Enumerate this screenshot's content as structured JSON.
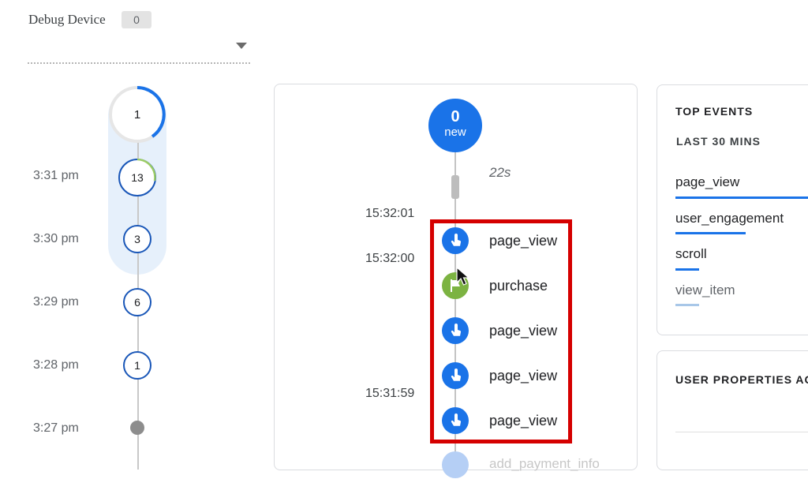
{
  "debug_device": {
    "label": "Debug Device",
    "count": "0"
  },
  "minutes": {
    "current_count": "1",
    "items": [
      {
        "time": "3:31 pm",
        "count": "13"
      },
      {
        "time": "3:30 pm",
        "count": "3"
      },
      {
        "time": "3:29 pm",
        "count": "6"
      },
      {
        "time": "3:28 pm",
        "count": "1"
      },
      {
        "time": "3:27 pm",
        "count": ""
      }
    ]
  },
  "stream": {
    "new_count": "0",
    "new_label": "new",
    "gap_label": "22s",
    "timestamps": [
      "15:32:01",
      "15:32:00",
      "15:31:59"
    ],
    "events": [
      {
        "name": "page_view",
        "icon": "touch-icon",
        "color": "#1a73e8"
      },
      {
        "name": "purchase",
        "icon": "flag-icon",
        "color": "#7cb342"
      },
      {
        "name": "page_view",
        "icon": "touch-icon",
        "color": "#1a73e8"
      },
      {
        "name": "page_view",
        "icon": "touch-icon",
        "color": "#1a73e8"
      },
      {
        "name": "page_view",
        "icon": "touch-icon",
        "color": "#1a73e8"
      }
    ],
    "faded_event": "add_payment_info",
    "highlight_color": "#d50000"
  },
  "top_events": {
    "title": "TOP EVENTS",
    "subtitle": "LAST 30 MINS",
    "items": [
      {
        "name": "page_view",
        "share": 1.0
      },
      {
        "name": "user_engagement",
        "share": 0.53
      },
      {
        "name": "scroll",
        "share": 0.18
      },
      {
        "name": "view_item",
        "share": 0.18
      }
    ]
  },
  "user_properties": {
    "title": "USER PROPERTIES AC"
  },
  "colors": {
    "accent": "#1a73e8",
    "purchase": "#7cb342",
    "highlight": "#d50000"
  }
}
